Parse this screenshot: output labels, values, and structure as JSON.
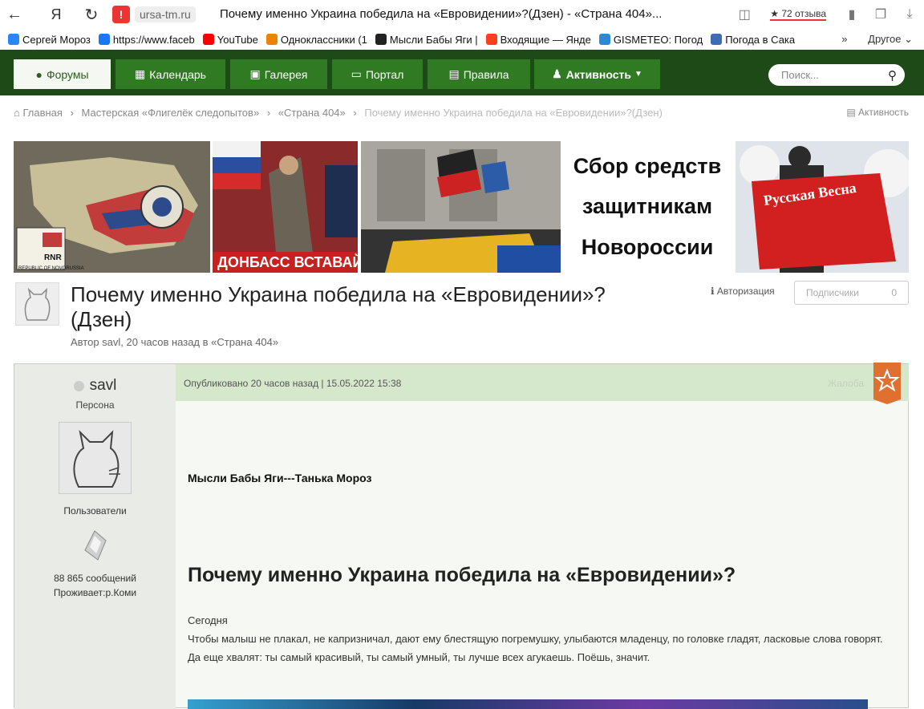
{
  "browser": {
    "domain": "ursa-tm.ru",
    "tab_title": "Почему именно Украина победила на «Евровидении»?(Дзен) - «Страна 404»...",
    "reviews": "★ 72 отзыва"
  },
  "bookmarks": [
    {
      "label": "Сергей Мороз",
      "color": "#2787f5"
    },
    {
      "label": "https://www.faceb",
      "color": "#1877f2"
    },
    {
      "label": "YouTube",
      "color": "#ff0000"
    },
    {
      "label": "Одноклассники (1",
      "color": "#ee8208"
    },
    {
      "label": "Мысли Бабы Яги |",
      "color": "#222222"
    },
    {
      "label": "Входящие — Янде",
      "color": "#fc3f1d"
    },
    {
      "label": "GISMETEO: Погод",
      "color": "#2b8ad8"
    },
    {
      "label": "Погода в Сака",
      "color": "#3d6cb2"
    }
  ],
  "bookmarks_other": "Другое",
  "nav": {
    "tabs": [
      {
        "label": "Форумы",
        "icon": "comment-icon",
        "active": true
      },
      {
        "label": "Календарь",
        "icon": "calendar-icon",
        "active": false
      },
      {
        "label": "Галерея",
        "icon": "image-icon",
        "active": false
      },
      {
        "label": "Портал",
        "icon": "laptop-icon",
        "active": false
      },
      {
        "label": "Правила",
        "icon": "newspaper-icon",
        "active": false
      },
      {
        "label": "Активность",
        "icon": "users-icon",
        "active": false
      }
    ],
    "search_placeholder": "Поиск..."
  },
  "breadcrumb": [
    "Главная",
    "Мастерская «Флигелёк следопытов»",
    "«Страна 404»",
    "Почему именно Украина победила на «Евровидении»?(Дзен)"
  ],
  "activity_link": "Активность",
  "banners": {
    "text_lines": [
      "Сбор средств",
      "защитникам",
      "Новороссии"
    ],
    "map_caption": "REPUBLIC OF NOVORUSSIA",
    "map_badge": "RNR",
    "poster_caption": "ДОНБАСС ВСТАВАЙ!",
    "flag_text": "Русская Весна"
  },
  "topic": {
    "title": "Почему именно Украина победила на «Евровидении»?(Дзен)",
    "meta": "Автор savl, 20 часов назад в «Страна 404»",
    "auth_label": "Авторизация",
    "subscribers_label": "Подписчики",
    "subscribers_count": "0"
  },
  "post": {
    "author": "savl",
    "rank": "Персона",
    "group": "Пользователи",
    "posts_count": "88 865 сообщений",
    "location": "Проживает:р.Коми",
    "published": "Опубликовано 20 часов назад | 15.05.2022 15:38",
    "report": "Жалоба",
    "blog_name": "Мысли Бабы Яги---Танька Мороз",
    "article_title": "Почему именно Украина победила на «Евровидении»?",
    "paragraphs": [
      "Сегодня",
      "Чтобы малыш не плакал, не капризничал, дают ему блестящую погремушку, улыбаются младенцу, по головке гладят, ласковые слова говорят. Да еще хвалят: ты самый красивый, ты самый умный, ты лучше всех агукаешь. Поёшь, значит."
    ]
  }
}
